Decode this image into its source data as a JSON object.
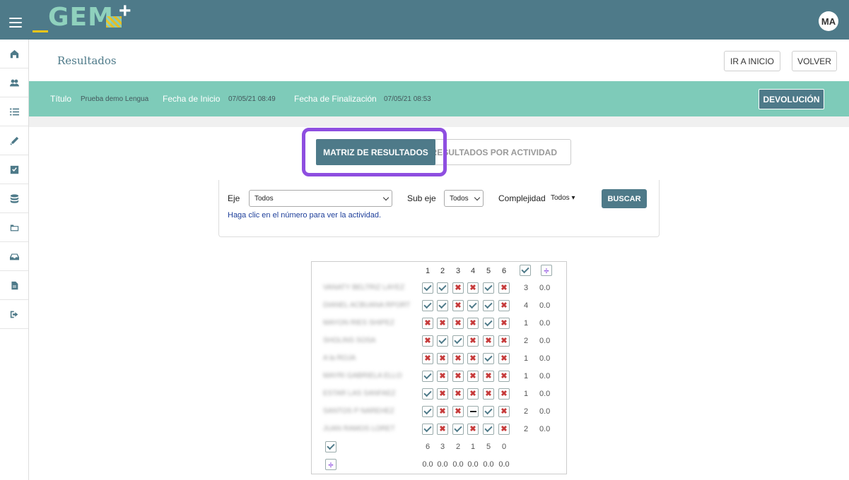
{
  "topbar": {
    "logo_text": "GEM",
    "avatar": "MA"
  },
  "sidebar": {
    "items": [
      "dashboard-icon",
      "users-icon",
      "list-icon",
      "pencil-icon",
      "checkbox-icon",
      "database-icon",
      "folder-icon",
      "inbox-icon",
      "document-icon",
      "logout-icon"
    ]
  },
  "header": {
    "title": "Resultados",
    "home_button": "IR A INICIO",
    "back_button": "VOLVER"
  },
  "info": {
    "title_label": "Título",
    "title_value": "Prueba demo Lengua",
    "start_label": "Fecha de Inicio",
    "start_value": "07/05/21 08:49",
    "end_label": "Fecha de Finalización",
    "end_value": "07/05/21 08:53",
    "devolucion_button": "DEVOLUCIÓN"
  },
  "tabs": {
    "matrix": "MATRIZ DE RESULTADOS",
    "activity": "RESULTADOS POR ACTIVIDAD"
  },
  "filters": {
    "eje_label": "Eje",
    "eje_value": "Todos",
    "subeje_label": "Sub eje",
    "subeje_value": "Todos",
    "complejidad_label": "Complejidad",
    "complejidad_value": "Todos ▾",
    "buscar_button": "BUSCAR",
    "hint": "Haga clic en el número para ver la actividad."
  },
  "matrix": {
    "columns": [
      "1",
      "2",
      "3",
      "4",
      "5",
      "6"
    ],
    "students": [
      {
        "name": "VANATY BELTRIZ LAYEZ",
        "answers": [
          "check",
          "check",
          "cross",
          "cross",
          "check",
          "cross"
        ],
        "correct": "3",
        "avg": "0.0"
      },
      {
        "name": "DIANEL ACBUANA RPORT",
        "answers": [
          "check",
          "check",
          "cross",
          "check",
          "check",
          "cross"
        ],
        "correct": "4",
        "avg": "0.0"
      },
      {
        "name": "MAYON RIES SHIPEZ",
        "answers": [
          "cross",
          "cross",
          "cross",
          "cross",
          "check",
          "cross"
        ],
        "correct": "1",
        "avg": "0.0"
      },
      {
        "name": "SHOLINS SOSA",
        "answers": [
          "cross",
          "check",
          "check",
          "cross",
          "cross",
          "cross"
        ],
        "correct": "2",
        "avg": "0.0"
      },
      {
        "name": "A la ROJA",
        "answers": [
          "cross",
          "cross",
          "cross",
          "cross",
          "check",
          "cross"
        ],
        "correct": "1",
        "avg": "0.0"
      },
      {
        "name": "MAYRI GABRIELA ELLO",
        "answers": [
          "check",
          "cross",
          "cross",
          "cross",
          "cross",
          "cross"
        ],
        "correct": "1",
        "avg": "0.0"
      },
      {
        "name": "ESTAR LAS SANFAEZ",
        "answers": [
          "check",
          "cross",
          "cross",
          "cross",
          "cross",
          "cross"
        ],
        "correct": "1",
        "avg": "0.0"
      },
      {
        "name": "SANTOS P NAREHEZ",
        "answers": [
          "check",
          "cross",
          "cross",
          "dash",
          "check",
          "cross"
        ],
        "correct": "2",
        "avg": "0.0"
      },
      {
        "name": "JUAN RAMOS LORET",
        "answers": [
          "check",
          "cross",
          "check",
          "cross",
          "check",
          "cross"
        ],
        "correct": "2",
        "avg": "0.0"
      }
    ],
    "column_totals": [
      "6",
      "3",
      "2",
      "1",
      "5",
      "0"
    ],
    "column_avgs": [
      "0.0",
      "0.0",
      "0.0",
      "0.0",
      "0.0",
      "0.0"
    ]
  },
  "colors": {
    "primary": "#4e7a89",
    "accent": "#7ecbb9",
    "highlight": "#8e4ee0",
    "wrong": "#c63b3b"
  }
}
